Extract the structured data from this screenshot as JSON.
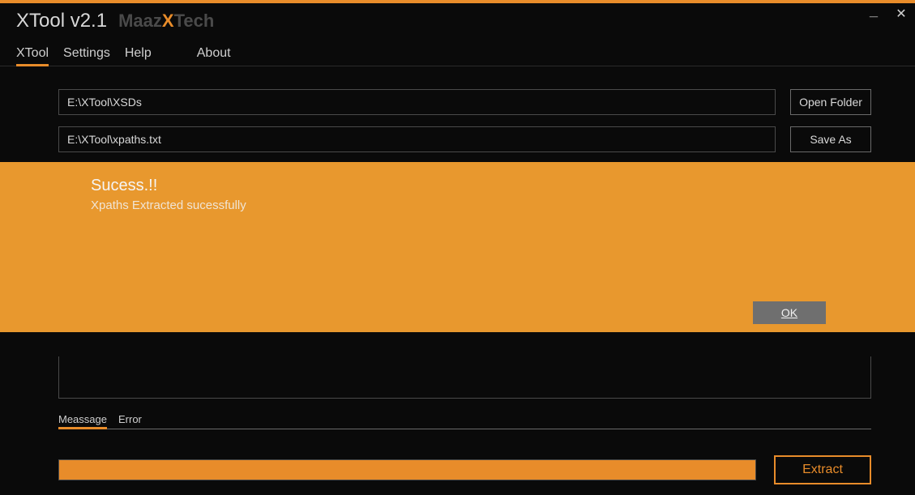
{
  "colors": {
    "accent": "#e88c2a",
    "bg": "#0a0a0a"
  },
  "title": "XTool  v2.1",
  "brand": {
    "part1": "Maaz",
    "accent": "X",
    "part2": "Tech"
  },
  "window": {
    "minimize": "_",
    "close": "✕"
  },
  "menu": {
    "items": [
      {
        "label": "XTool",
        "active": true
      },
      {
        "label": "Settings",
        "active": false
      },
      {
        "label": "Help",
        "active": false
      },
      {
        "label": "About",
        "active": false
      }
    ]
  },
  "inputs": {
    "folder_path": "E:\\XTool\\XSDs",
    "save_path": "E:\\XTool\\xpaths.txt"
  },
  "buttons": {
    "open_folder": "Open Folder",
    "save_as": "Save As",
    "extract": "Extract",
    "ok": "OK"
  },
  "dialog": {
    "title": "Sucess.!!",
    "message": "Xpaths Extracted sucessfully"
  },
  "tabs": [
    {
      "label": "Meassage",
      "active": true
    },
    {
      "label": "Error",
      "active": false
    }
  ],
  "progress_percent": 100
}
